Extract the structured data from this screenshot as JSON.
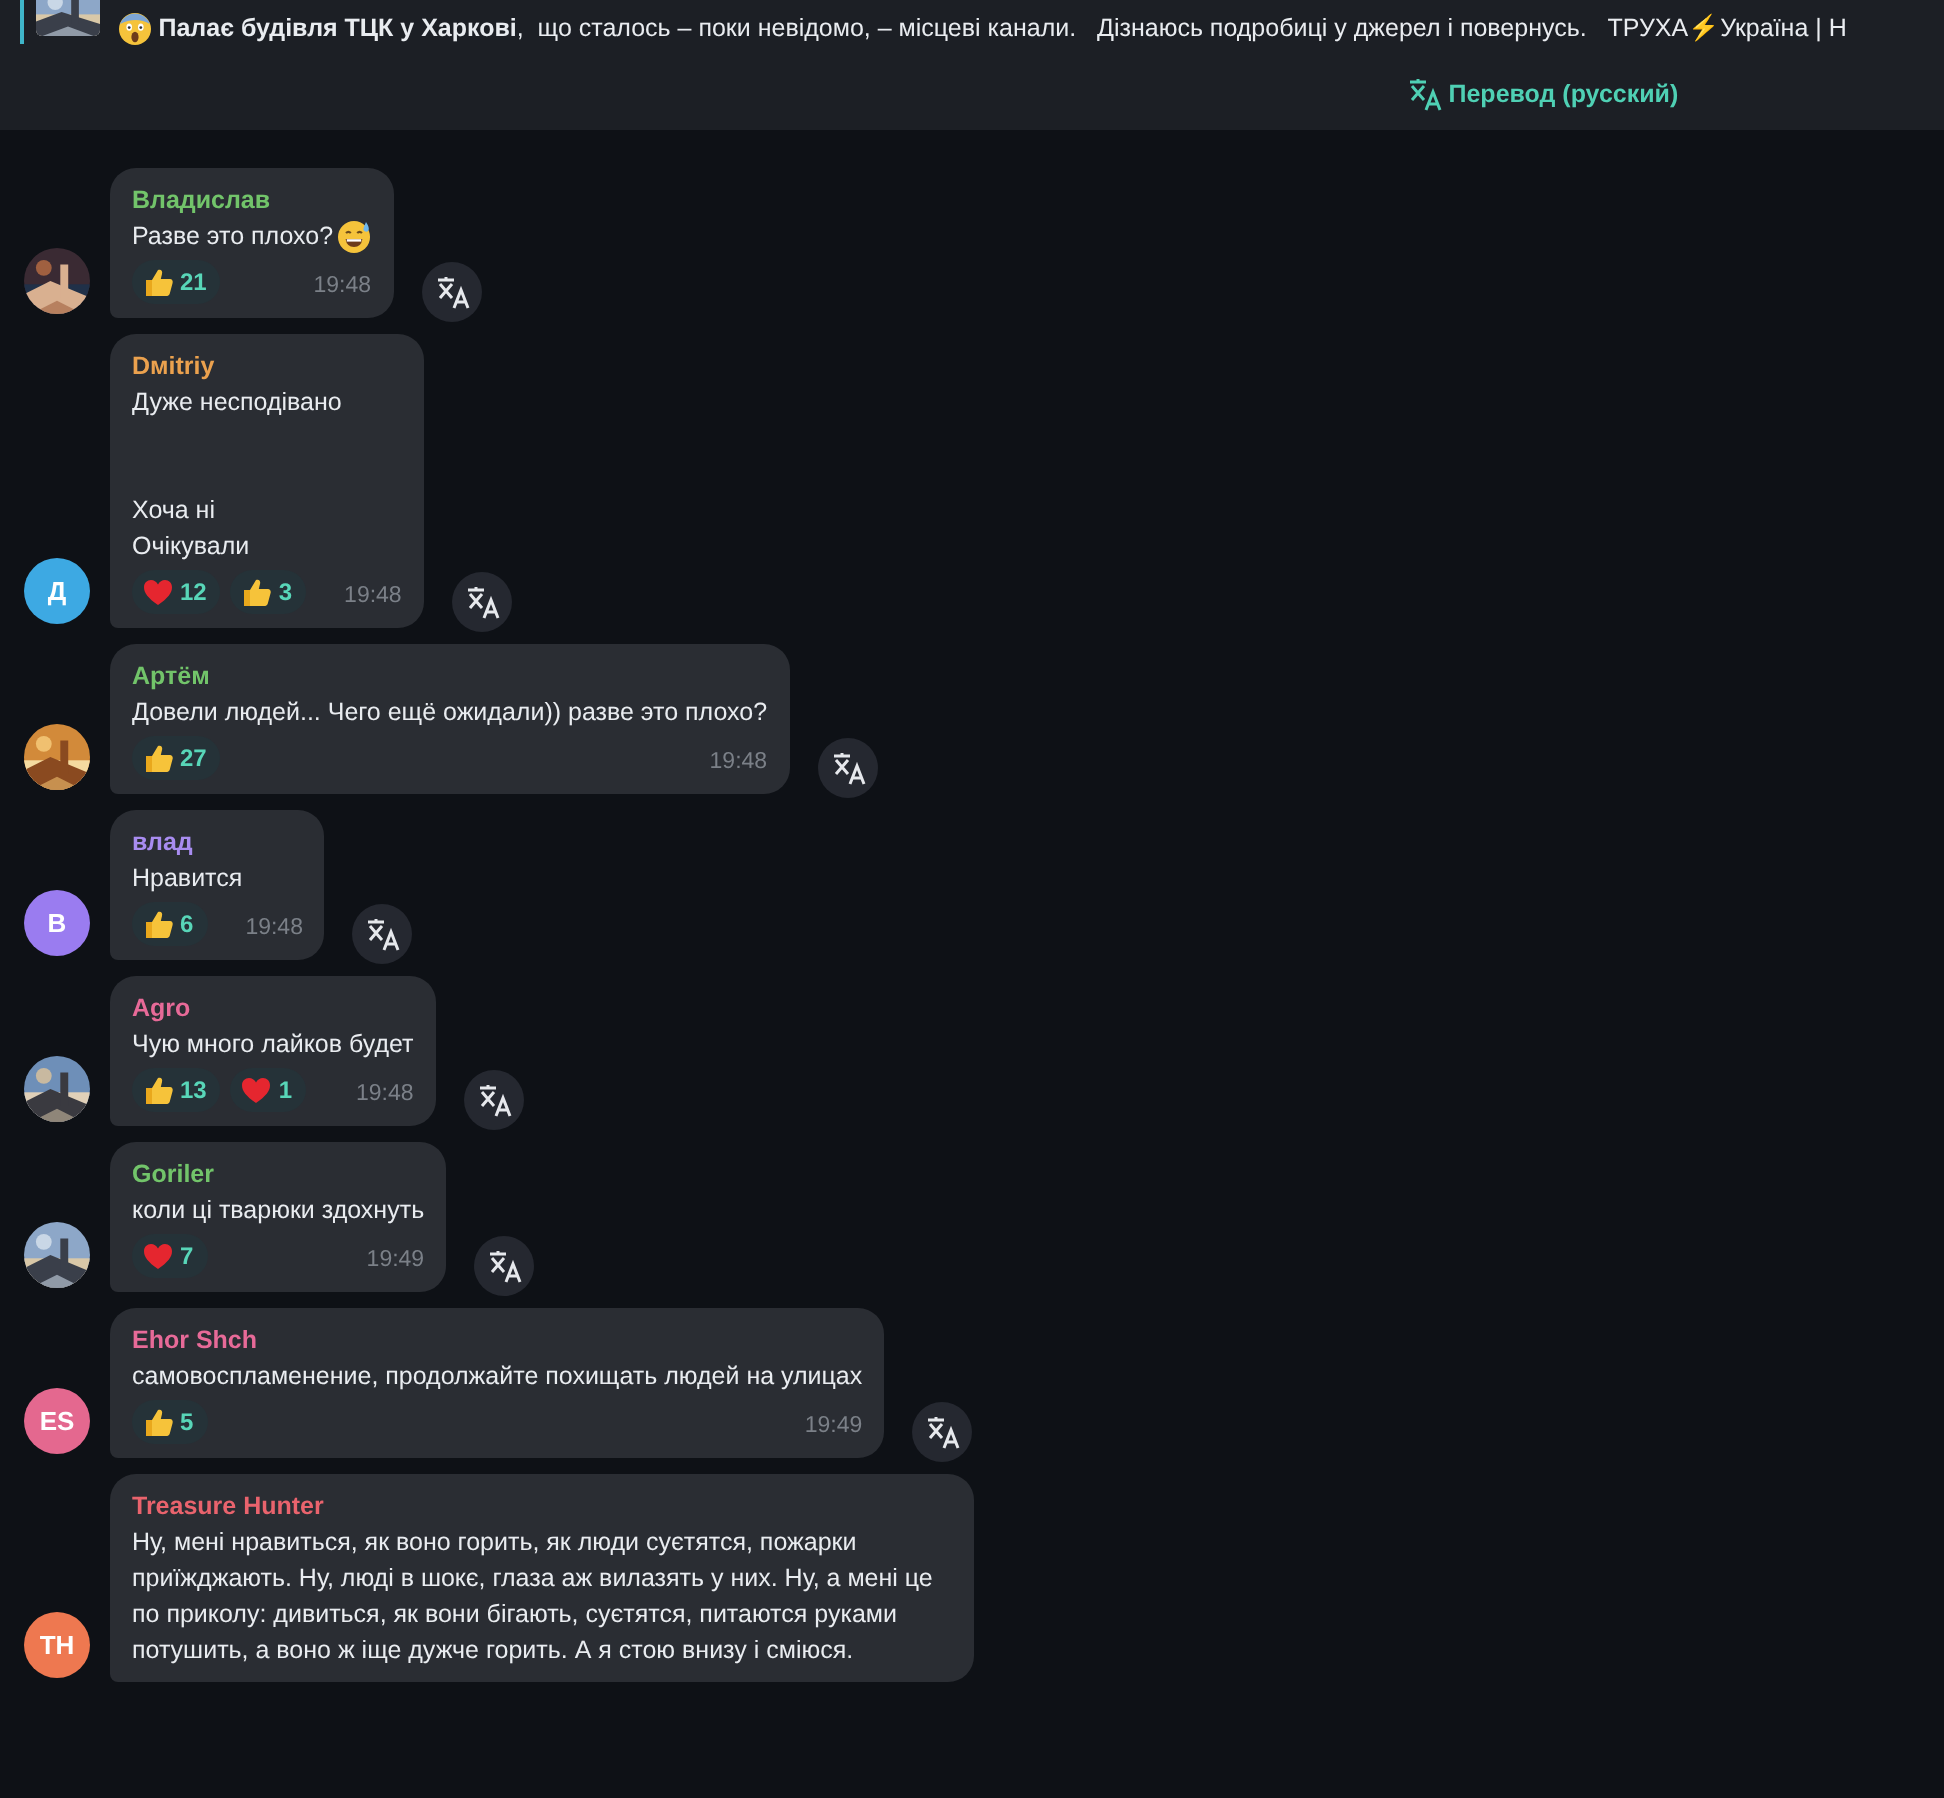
{
  "pinned": {
    "kind": "emoji",
    "text": "**Палає будівля ТЦК у Харкові**,  що сталось – поки невідомо, – місцеві канали.   Дізнаюсь подробиці у джерел і повернусь.   ТРУХА⚡Україна | Н",
    "translate": "Перевод (русский)"
  },
  "messages": [
    {
      "name": "Владислав",
      "color": "#72c46a",
      "avatar": {
        "kind": "picture"
      },
      "text": "Разве это плохо?",
      "kind": "emoji",
      "reactions": [
        {
          "kind": "like",
          "count": "21"
        }
      ],
      "time": "19:48"
    },
    {
      "name": "Dмitriy",
      "color": "#eba14e",
      "avatar": {
        "kind": "initials",
        "initials": "Д",
        "color": "#3da9e3"
      },
      "text": "Дуже несподівано\n\n\nХоча ні\nОчікували",
      "reactions": [
        {
          "kind": "heart",
          "count": "12"
        },
        {
          "kind": "like",
          "count": "3"
        }
      ],
      "time": "19:48"
    },
    {
      "name": "Артём",
      "color": "#72c46a",
      "avatar": {
        "kind": "picture"
      },
      "text": "Довели людей... Чего ещё ожидали)) разве это плохо?",
      "reactions": [
        {
          "kind": "like",
          "count": "27"
        }
      ],
      "time": "19:48"
    },
    {
      "name": "влад",
      "color": "#a88cf0",
      "avatar": {
        "kind": "initials",
        "initials": "В",
        "color": "#9a7cf0"
      },
      "text": "Нравится",
      "reactions": [
        {
          "kind": "like",
          "count": "6"
        }
      ],
      "time": "19:48"
    },
    {
      "name": "Agro",
      "color": "#e76a98",
      "avatar": {
        "kind": "picture"
      },
      "text": "Чую много лайков будет",
      "reactions": [
        {
          "kind": "like",
          "count": "13"
        },
        {
          "kind": "heart",
          "count": "1"
        }
      ],
      "time": "19:48"
    },
    {
      "name": "Goriler",
      "color": "#72c46a",
      "avatar": {
        "kind": "picture"
      },
      "text": "коли ці тварюки здохнуть",
      "reactions": [
        {
          "kind": "heart",
          "count": "7"
        }
      ],
      "time": "19:49"
    },
    {
      "name": "Ehor Shch",
      "color": "#e76a98",
      "avatar": {
        "kind": "initials",
        "initials": "ES",
        "color": "#e4688f"
      },
      "text": "самовоспламенение, продолжайте похищать людей на улицах",
      "reactions": [
        {
          "kind": "like",
          "count": "5"
        }
      ],
      "time": "19:49"
    },
    {
      "name": "Treasure Hunter",
      "color": "#e9636d",
      "avatar": {
        "kind": "initials",
        "initials": "TH",
        "color": "#ee7850"
      },
      "text": "Ну, мені нравиться, як воно горить, як люди суєтятся, пожарки приїжджають. Ну, люді в шокє, глаза аж вилазять у них. Ну, а мені це по приколу: дивиться, як вони бігають, суєтятся, питаются руками потушить, а воно ж іще дужче горить. А я стою внизу і сміюся."
    }
  ]
}
